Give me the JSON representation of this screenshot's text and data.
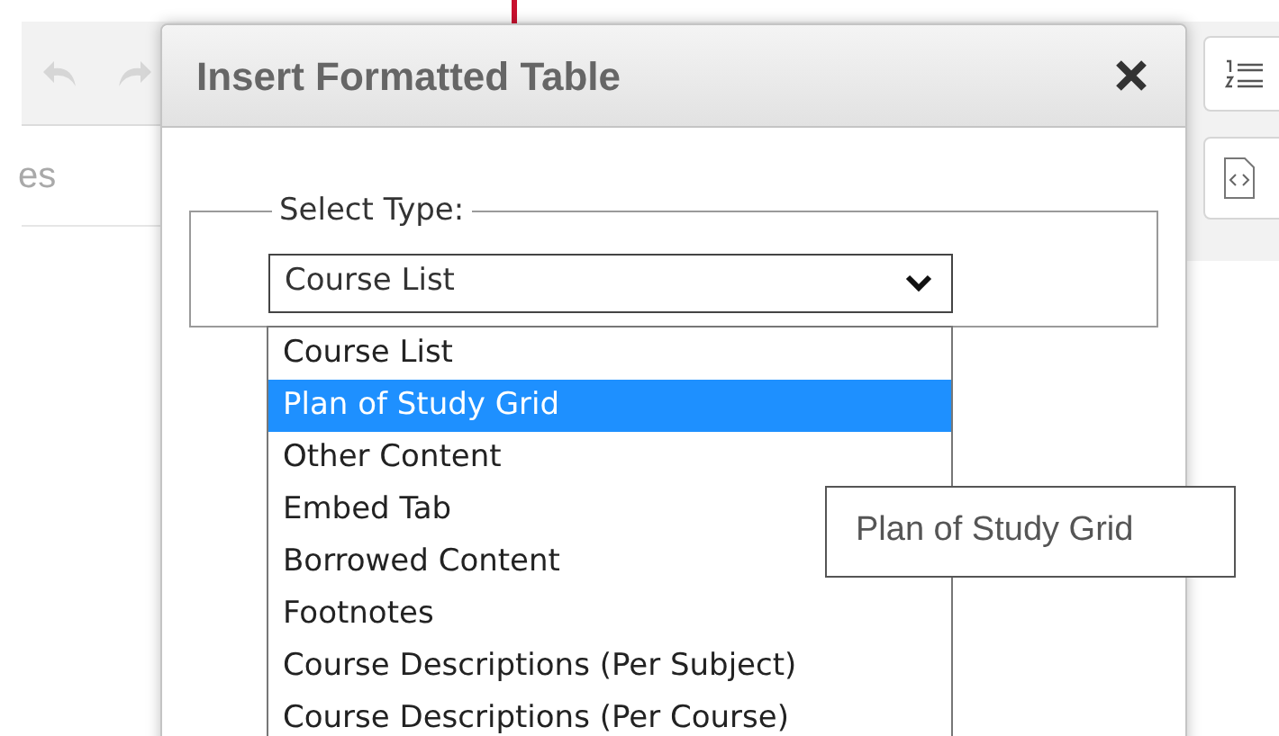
{
  "editor": {
    "label_fragment": "es"
  },
  "dialog": {
    "title": "Insert Formatted Table",
    "legend": "Select Type:",
    "select": {
      "value": "Course List",
      "expanded": true
    },
    "options": [
      {
        "label": "Course List",
        "selected": false
      },
      {
        "label": "Plan of Study Grid",
        "selected": true
      },
      {
        "label": "Other Content",
        "selected": false
      },
      {
        "label": "Embed Tab",
        "selected": false
      },
      {
        "label": "Borrowed Content",
        "selected": false
      },
      {
        "label": "Footnotes",
        "selected": false
      },
      {
        "label": "Course Descriptions (Per Subject)",
        "selected": false
      },
      {
        "label": "Course Descriptions (Per Course)",
        "selected": false
      }
    ]
  },
  "tooltip": {
    "text": "Plan of Study Grid"
  }
}
